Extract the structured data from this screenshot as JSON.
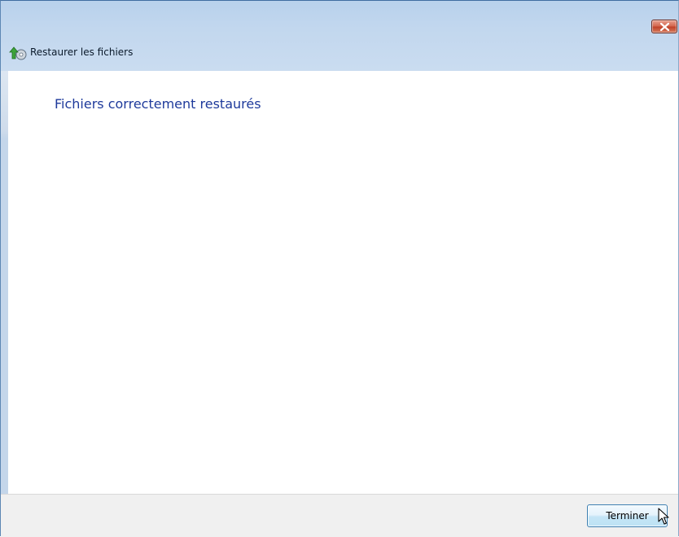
{
  "window": {
    "title": "Restaurer les fichiers"
  },
  "page": {
    "heading": "Fichiers correctement restaurés"
  },
  "footer": {
    "finish_label": "Terminer"
  },
  "icons": {
    "app": "restore-files-icon",
    "close": "close-icon",
    "cursor": "mouse-pointer-icon"
  }
}
